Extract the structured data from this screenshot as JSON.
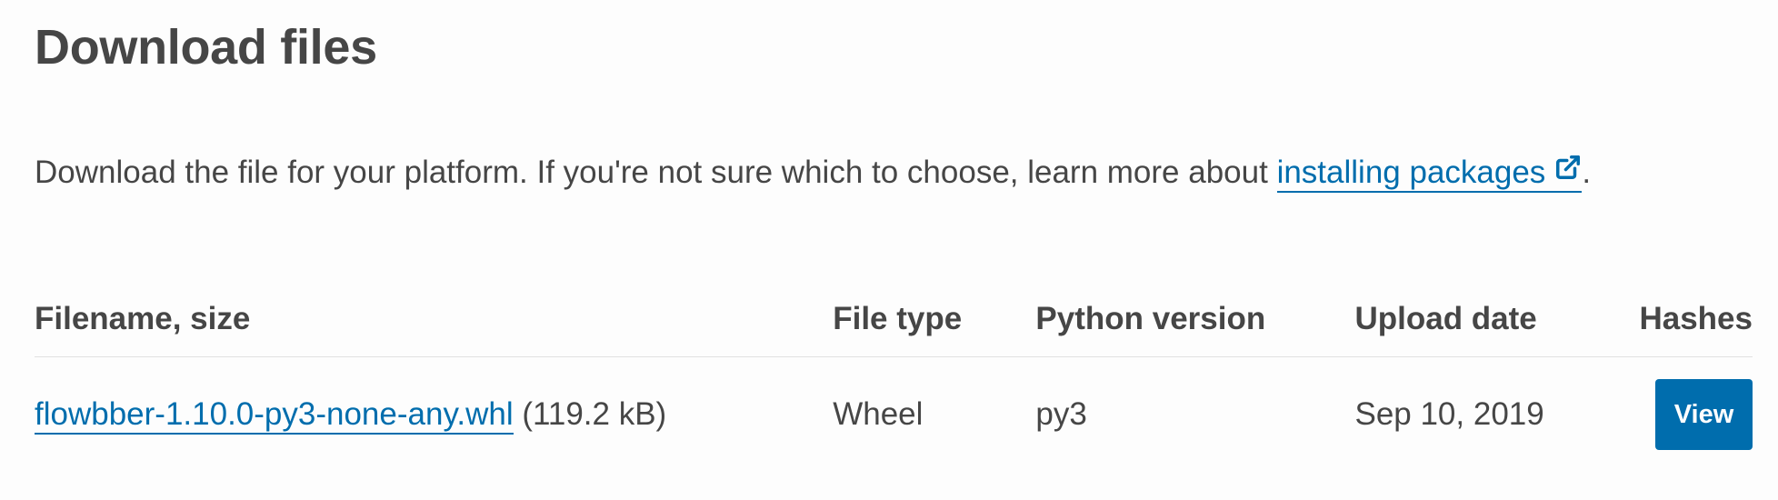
{
  "section": {
    "title": "Download files",
    "intro_text": "Download the file for your platform. If you're not sure which to choose, learn more about ",
    "intro_link": "installing packages",
    "intro_suffix": "."
  },
  "table": {
    "headers": {
      "filename": "Filename, size",
      "file_type": "File type",
      "python_version": "Python version",
      "upload_date": "Upload date",
      "hashes": "Hashes"
    },
    "rows": [
      {
        "filename": "flowbber-1.10.0-py3-none-any.whl",
        "size": "(119.2 kB)",
        "file_type": "Wheel",
        "python_version": "py3",
        "upload_date": "Sep 10, 2019",
        "hash_button": "View"
      }
    ]
  },
  "colors": {
    "link": "#006dad",
    "button": "#006dad",
    "text": "#464646"
  },
  "icons": {
    "external_link": "external-link-icon"
  }
}
